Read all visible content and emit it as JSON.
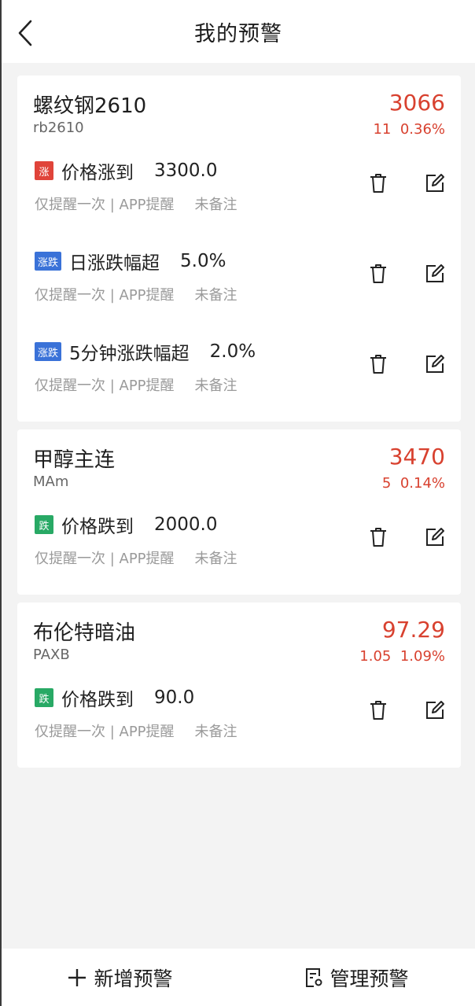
{
  "header": {
    "title": "我的预警"
  },
  "cards": [
    {
      "name": "螺纹钢2610",
      "code": "rb2610",
      "price": "3066",
      "change": "11  0.36%",
      "alerts": [
        {
          "tag": "涨",
          "condition": "价格涨到",
          "value": "3300.0",
          "frequency": "仅提醒一次 | APP提醒",
          "note": "未备注"
        },
        {
          "tag": "涨跌",
          "condition": "日涨跌幅超",
          "value": "5.0%",
          "frequency": "仅提醒一次 | APP提醒",
          "note": "未备注"
        },
        {
          "tag": "涨跌",
          "condition": "5分钟涨跌幅超",
          "value": "2.0%",
          "frequency": "仅提醒一次 | APP提醒",
          "note": "未备注"
        }
      ]
    },
    {
      "name": "甲醇主连",
      "code": "MAm",
      "price": "3470",
      "change": "5  0.14%",
      "alerts": [
        {
          "tag": "跌",
          "condition": "价格跌到",
          "value": "2000.0",
          "frequency": "仅提醒一次 | APP提醒",
          "note": "未备注"
        }
      ]
    },
    {
      "name": "布伦特暗油",
      "code": "PAXB",
      "price": "97.29",
      "change": "1.05  1.09%",
      "alerts": [
        {
          "tag": "跌",
          "condition": "价格跌到",
          "value": "90.0",
          "frequency": "仅提醒一次 | APP提醒",
          "note": "未备注"
        }
      ]
    }
  ],
  "bottom": {
    "add_label": "新增预警",
    "manage_label": "管理预警"
  },
  "colors": {
    "up": "#d8412f",
    "up_tag": "#e0443a",
    "down_tag": "#28a965",
    "range_tag": "#3a72d8"
  },
  "icons": {
    "back": "chevron-left-icon",
    "delete": "trash-icon",
    "edit": "edit-icon",
    "add": "plus-icon",
    "manage": "document-gear-icon"
  }
}
